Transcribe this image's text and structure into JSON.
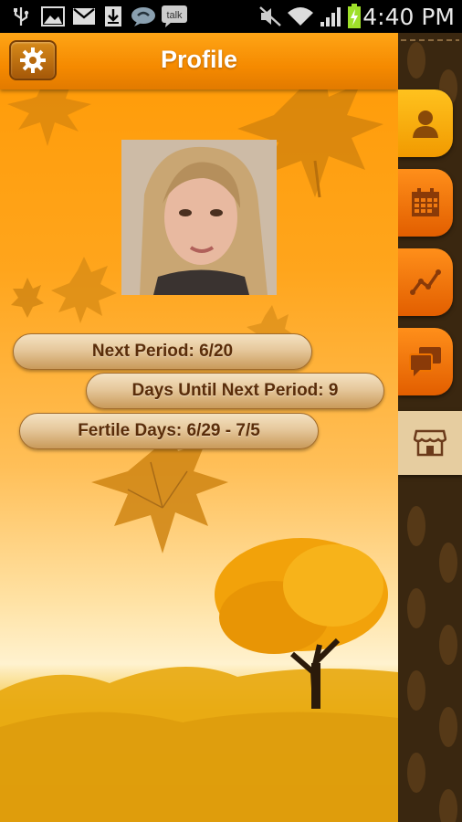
{
  "status_bar": {
    "time": "4:40 PM",
    "icons": [
      "usb-icon",
      "image-icon",
      "gmail-icon",
      "download-icon",
      "chat-bubble-icon",
      "talk-icon",
      "mute-icon",
      "wifi-icon",
      "signal-icon",
      "battery-charging-icon"
    ],
    "talk_label": "talk"
  },
  "header": {
    "title": "Profile",
    "settings_icon": "gear-icon"
  },
  "profile": {
    "photo": "profile-photo"
  },
  "info": {
    "next_period": "Next Period: 6/20",
    "days_until": "Days Until Next Period: 9",
    "fertile_days": "Fertile Days: 6/29 - 7/5"
  },
  "sidebar": {
    "tabs": [
      {
        "name": "profile",
        "icon": "person-icon",
        "active": true
      },
      {
        "name": "calendar",
        "icon": "calendar-icon",
        "active": false
      },
      {
        "name": "chart",
        "icon": "chart-icon",
        "active": false
      },
      {
        "name": "forum",
        "icon": "chat-icon",
        "active": false
      },
      {
        "name": "shop",
        "icon": "shop-icon",
        "active": false
      }
    ]
  },
  "colors": {
    "accent": "#f58a00",
    "tab_active": "#ffb60f",
    "tab_inactive": "#f07400",
    "pill_text": "#5a2d0a"
  }
}
